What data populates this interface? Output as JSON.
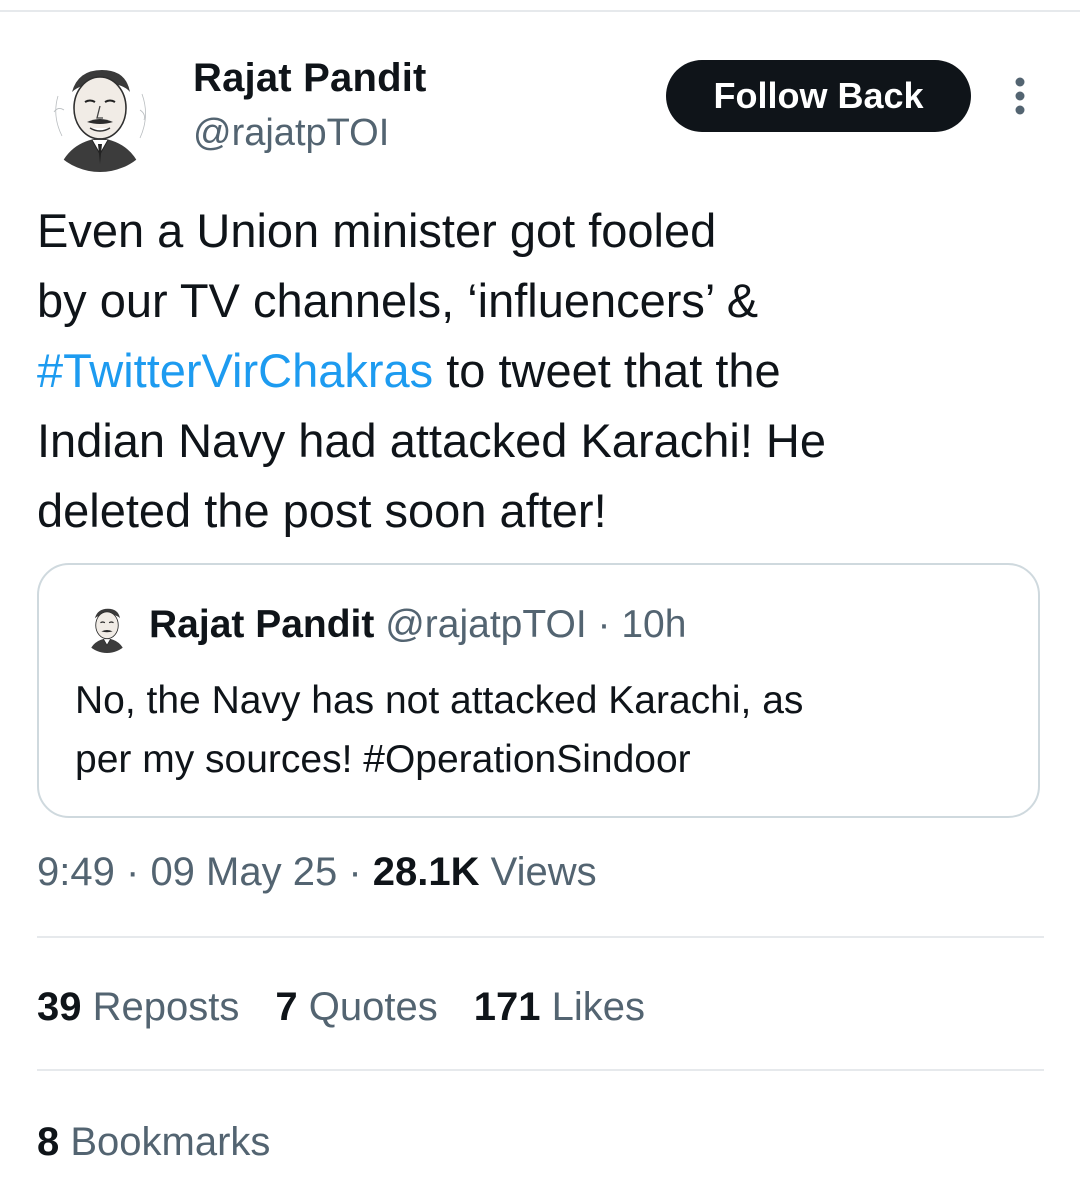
{
  "author": {
    "display_name": "Rajat Pandit",
    "handle": "@rajatpTOI",
    "follow_label": "Follow Back",
    "more_icon": "vertical-ellipsis-icon"
  },
  "tweet": {
    "line1": "Even a Union minister got fooled",
    "line2": "by our TV channels, ‘influencers’ &",
    "line3_hashtag": "#TwitterVirChakras",
    "line3_rest": " to tweet that the",
    "line4": "Indian Navy had attacked Karachi! He",
    "line5": "deleted the post soon after!"
  },
  "quoted": {
    "display_name": "Rajat Pandit",
    "handle": "@rajatpTOI",
    "separator": "·",
    "age": "10h",
    "line1": "No, the Navy has not attacked Karachi, as",
    "line2": "per my sources! #OperationSindoor"
  },
  "meta": {
    "time": "9:49",
    "separator": "·",
    "date": "09 May 25",
    "views_count": "28.1K",
    "views_label": "Views"
  },
  "stats": {
    "reposts_count": "39",
    "reposts_label": "Reposts",
    "quotes_count": "7",
    "quotes_label": "Quotes",
    "likes_count": "171",
    "likes_label": "Likes",
    "bookmarks_count": "8",
    "bookmarks_label": "Bookmarks"
  },
  "colors": {
    "text": "#0f1419",
    "secondary": "#536471",
    "link": "#1d9bf0",
    "border": "#cfd9de",
    "button_bg": "#0f1419"
  }
}
